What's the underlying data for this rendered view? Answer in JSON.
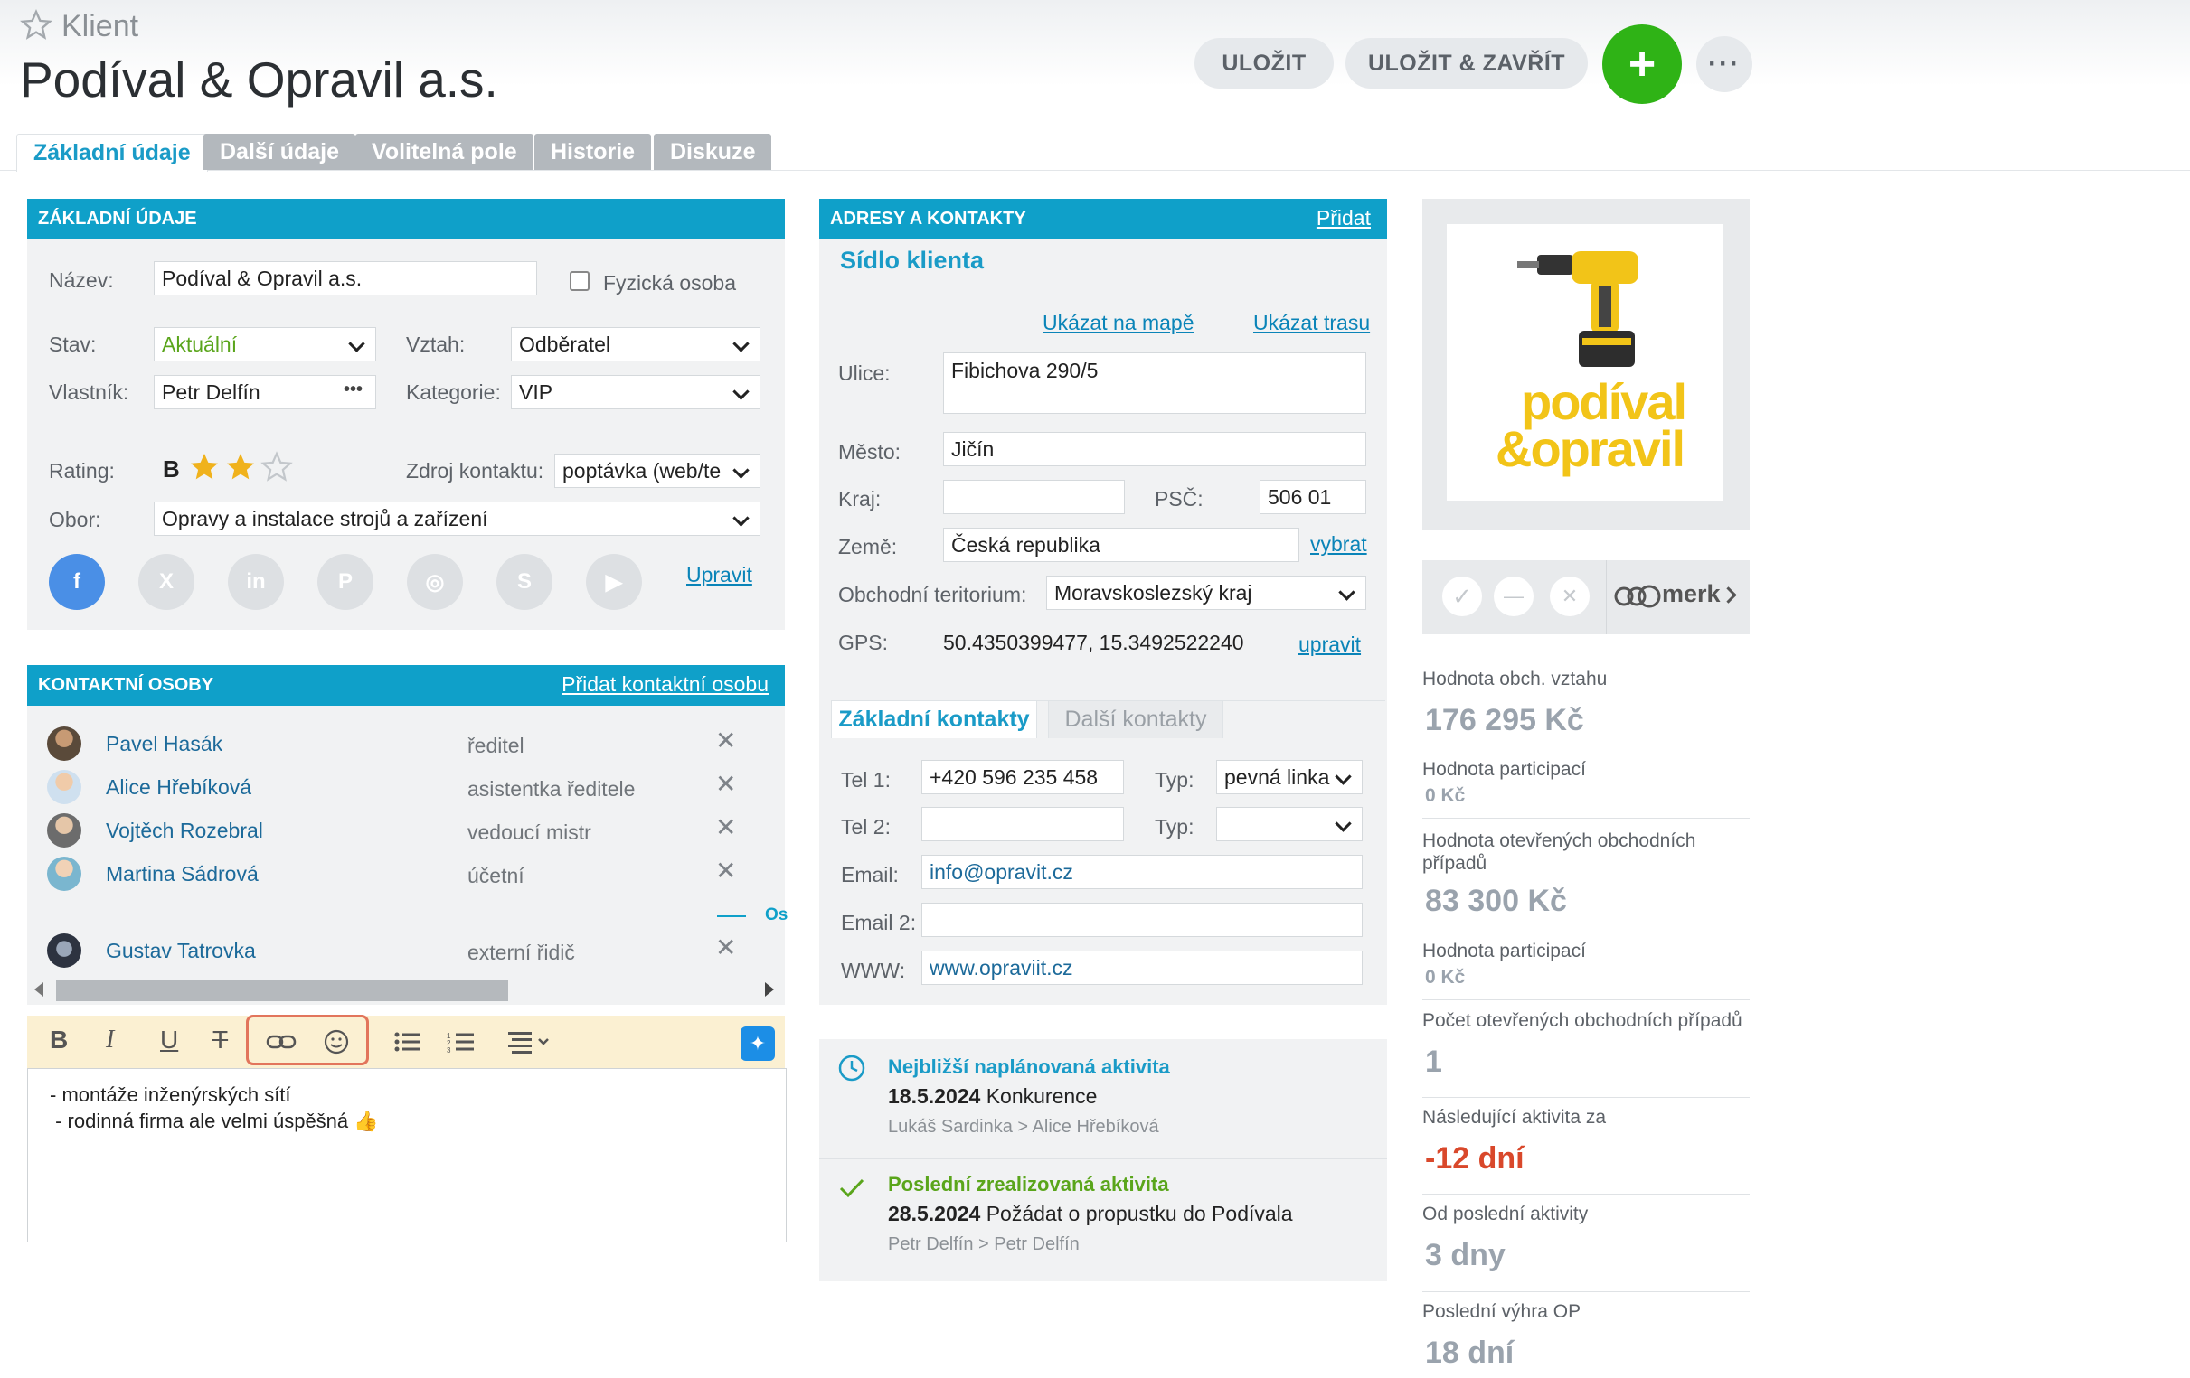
{
  "header": {
    "breadcrumb": "Klient",
    "title": "Podíval & Opravil a.s.",
    "save_label": "ULOŽIT",
    "save_close_label": "ULOŽIT & ZAVŘÍT",
    "add_label": "+",
    "more_label": "···"
  },
  "tabs": [
    {
      "label": "Základní údaje"
    },
    {
      "label": "Další údaje"
    },
    {
      "label": "Volitelná pole"
    },
    {
      "label": "Historie"
    },
    {
      "label": "Diskuze"
    }
  ],
  "basic": {
    "heading": "ZÁKLADNÍ ÚDAJE",
    "name_label": "Název:",
    "name_value": "Podíval & Opravil a.s.",
    "person_label": "Fyzická osoba",
    "status_label": "Stav:",
    "status_value": "Aktuální",
    "relation_label": "Vztah:",
    "relation_value": "Odběratel",
    "owner_label": "Vlastník:",
    "owner_value": "Petr Delfín",
    "owner_more": "•••",
    "category_label": "Kategorie:",
    "category_value": "VIP",
    "rating_label": "Rating:",
    "rating_letter": "B",
    "rating_stars": 2,
    "rating_max": 3,
    "source_label": "Zdroj kontaktu:",
    "source_value": "poptávka (web/te",
    "field_label": "Obor:",
    "field_value": "Opravy a instalace strojů a zařízení",
    "social": [
      "f",
      "X",
      "in",
      "P",
      "◎",
      "S",
      "▶"
    ],
    "edit_link": "Upravit"
  },
  "contacts": {
    "heading": "KONTAKTNÍ OSOBY",
    "add_link": "Přidat kontaktní osobu",
    "people": [
      {
        "name": "Pavel Hasák",
        "role": "ředitel"
      },
      {
        "name": "Alice Hřebíková",
        "role": "asistentka ředitele"
      },
      {
        "name": "Vojtěch Rozebral",
        "role": "vedoucí mistr"
      },
      {
        "name": "Martina Sádrová",
        "role": "účetní"
      },
      {
        "name": "Gustav Tatrovka",
        "role": "externí řidič"
      }
    ],
    "remove_glyph": "✕",
    "cut_label": "Os"
  },
  "editor": {
    "line1": "- montáže inženýrských sítí",
    "line2": " - rodinná firma ale velmi úspěšná 👍"
  },
  "address": {
    "heading": "ADRESY A KONTAKTY",
    "add_link": "Přidat",
    "section_title": "Sídlo klienta",
    "map_link": "Ukázat na mapě",
    "route_link": "Ukázat trasu",
    "street_label": "Ulice:",
    "street_value": "Fibichova 290/5",
    "city_label": "Město:",
    "city_value": "Jičín",
    "region_label": "Kraj:",
    "region_value": "",
    "zip_label": "PSČ:",
    "zip_value": "506 01",
    "country_label": "Země:",
    "country_value": "Česká republika",
    "choose_link": "vybrat",
    "territory_label": "Obchodní teritorium:",
    "territory_value": "Moravskoslezský kraj",
    "gps_label": "GPS:",
    "gps_value": "50.4350399477, 15.3492522240",
    "gps_edit": "upravit",
    "tab_basic": "Základní kontakty",
    "tab_more": "Další kontakty",
    "tel1_label": "Tel 1:",
    "tel1_value": "+420 596 235 458",
    "type_label": "Typ:",
    "type1_value": "pevná linka",
    "tel2_label": "Tel 2:",
    "tel2_value": "",
    "type2_value": "",
    "email_label": "Email:",
    "email_value": "info@opravit.cz",
    "email2_label": "Email 2:",
    "email2_value": "",
    "www_label": "WWW:",
    "www_value": "www.opraviit.cz"
  },
  "activity": {
    "next_title": "Nejbližší naplánovaná aktivita",
    "next_date": "18.5.2024",
    "next_subject": "Konkurence",
    "next_people": "Lukáš Sardinka > Alice Hřebíková",
    "last_title": "Poslední zrealizovaná aktivita",
    "last_date": "28.5.2024",
    "last_subject": "Požádat o propustku do Podívala",
    "last_people": "Petr Delfín > Petr Delfín"
  },
  "logo": {
    "line1": "podíval",
    "line2": "&opravil"
  },
  "merk": {
    "label": "merk",
    "check": "✓",
    "minus": "—",
    "close": "✕"
  },
  "stats": [
    {
      "label": "Hodnota obch. vztahu",
      "value": "176 295 Kč"
    },
    {
      "label": "Hodnota participací",
      "value": "0 Kč"
    },
    {
      "label": "Hodnota otevřených obchodních případů",
      "value": "83 300 Kč"
    },
    {
      "label": "Hodnota participací",
      "value": "0 Kč"
    },
    {
      "label": "Počet otevřených obchodních případů",
      "value": "1"
    },
    {
      "label": "Následující aktivita za",
      "value": "-12 dní"
    },
    {
      "label": "Od poslední aktivity",
      "value": "3 dny"
    },
    {
      "label": "Poslední výhra OP",
      "value": "18 dní"
    }
  ],
  "colors": {
    "accent": "#0fa0c9",
    "add_button": "#2fb316",
    "negative": "#d9482b",
    "status_green": "#5aa51b",
    "star": "#f0b21c"
  }
}
